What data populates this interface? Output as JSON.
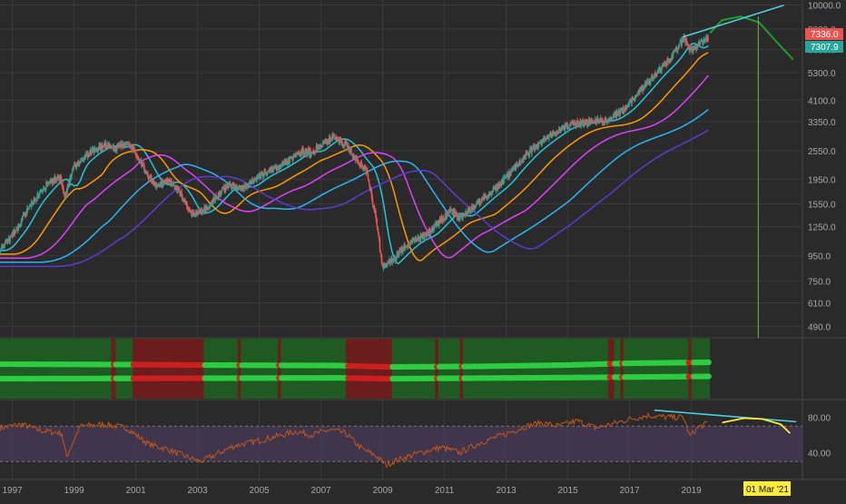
{
  "colors": {
    "background": "#2a2a2a",
    "grid": "#3a3a3a",
    "text": "#a8a8a8",
    "candle_up": "#26a69a",
    "candle_down": "#ef5350",
    "ema_short": "#26c6da",
    "ema_orange": "#ff9800",
    "ema_magenta": "#e040fb",
    "ema_blue": "#29b6f6",
    "ema_purple": "#5c3bd6",
    "projection": "#1f9e2b",
    "trendline": "#4dd0e1",
    "vertical_marker": "#7cb342",
    "rsi_line": "#c2571a",
    "rsi_band": "#4a3a5c",
    "rsi_arc": "#ffeb3b",
    "ribbon_green": "#1e5a22",
    "ribbon_red": "#6b1c1c",
    "ribbon_dot_green": "#2ecc40",
    "ribbon_dot_red": "#cc1f1f",
    "price_tag_red": "#ef5350",
    "price_tag_green": "#26a69a",
    "date_tag": "#ffeb3b"
  },
  "price_labels": {
    "current_red": "7336.0",
    "current_green": "7307.9"
  },
  "date_marker": "01 Mar '21",
  "chart_data": [
    {
      "type": "candlestick",
      "panel": "price",
      "scale": "log",
      "ylim": [
        440,
        10500
      ],
      "y_ticks": [
        "10000.0",
        "8000.0",
        "6600.0",
        "5300.0",
        "4100.0",
        "3350.0",
        "2550.0",
        "1950.0",
        "1550.0",
        "1250.0",
        "950.0",
        "750.0",
        "610.0",
        "490.0"
      ],
      "x_ticks": [
        "1997",
        "1999",
        "2001",
        "2003",
        "2005",
        "2007",
        "2009",
        "2011",
        "2013",
        "2015",
        "2017",
        "2019"
      ],
      "x_range": [
        1996.6,
        2022.6
      ],
      "price_path": [
        [
          1996.6,
          1000
        ],
        [
          1997.2,
          1250
        ],
        [
          1997.6,
          1550
        ],
        [
          1998.2,
          1900
        ],
        [
          1998.55,
          2000
        ],
        [
          1998.7,
          1650
        ],
        [
          1999.0,
          2200
        ],
        [
          1999.5,
          2500
        ],
        [
          2000.0,
          2700
        ],
        [
          2000.3,
          2600
        ],
        [
          2000.7,
          2750
        ],
        [
          2001.0,
          2500
        ],
        [
          2001.4,
          2000
        ],
        [
          2001.7,
          1800
        ],
        [
          2002.0,
          1950
        ],
        [
          2002.4,
          1750
        ],
        [
          2002.8,
          1400
        ],
        [
          2003.2,
          1450
        ],
        [
          2003.6,
          1650
        ],
        [
          2004.0,
          1850
        ],
        [
          2004.5,
          1800
        ],
        [
          2005.0,
          2000
        ],
        [
          2005.5,
          2150
        ],
        [
          2006.0,
          2350
        ],
        [
          2006.4,
          2550
        ],
        [
          2006.7,
          2500
        ],
        [
          2007.0,
          2700
        ],
        [
          2007.4,
          2900
        ],
        [
          2007.8,
          2700
        ],
        [
          2008.2,
          2300
        ],
        [
          2008.5,
          2100
        ],
        [
          2008.8,
          1300
        ],
        [
          2009.0,
          850
        ],
        [
          2009.25,
          900
        ],
        [
          2009.6,
          1000
        ],
        [
          2010.0,
          1100
        ],
        [
          2010.4,
          1150
        ],
        [
          2010.8,
          1300
        ],
        [
          2011.2,
          1450
        ],
        [
          2011.5,
          1350
        ],
        [
          2011.8,
          1450
        ],
        [
          2012.3,
          1650
        ],
        [
          2012.8,
          1850
        ],
        [
          2013.3,
          2200
        ],
        [
          2013.8,
          2550
        ],
        [
          2014.3,
          2850
        ],
        [
          2014.8,
          3150
        ],
        [
          2015.3,
          3300
        ],
        [
          2015.8,
          3350
        ],
        [
          2016.3,
          3400
        ],
        [
          2016.8,
          3750
        ],
        [
          2017.3,
          4400
        ],
        [
          2017.8,
          5200
        ],
        [
          2018.3,
          6000
        ],
        [
          2018.75,
          7300
        ],
        [
          2019.0,
          6500
        ],
        [
          2019.3,
          7000
        ],
        [
          2019.55,
          7300
        ]
      ],
      "down_periods": [
        [
          2001.0,
          2003.2
        ],
        [
          2007.8,
          2009.3
        ],
        [
          2018.75,
          2019.05
        ],
        [
          2011.4,
          2011.9
        ]
      ],
      "ema_lags": [
        0.35,
        0.9,
        1.6,
        2.6,
        3.6
      ],
      "series": [
        {
          "role": "ema_short",
          "lag": 0.35
        },
        {
          "role": "ema_orange",
          "lag": 0.9
        },
        {
          "role": "ema_magenta",
          "lag": 1.6
        },
        {
          "role": "ema_blue",
          "lag": 2.6
        },
        {
          "role": "ema_purple",
          "lag": 3.6
        }
      ],
      "projection": [
        [
          2019.6,
          7700
        ],
        [
          2020.0,
          8700
        ],
        [
          2020.6,
          9000
        ],
        [
          2021.2,
          8500
        ],
        [
          2021.8,
          7000
        ],
        [
          2022.3,
          6000
        ]
      ],
      "trendline": [
        [
          2018.7,
          7400
        ],
        [
          2022.0,
          10000
        ]
      ],
      "vertical_marker_x": 2021.17
    },
    {
      "type": "ribbon",
      "panel": "trend_ribbon",
      "x_range": [
        1996.6,
        2019.6
      ],
      "red_spans": [
        [
          2000.2,
          2000.35
        ],
        [
          2000.9,
          2003.2
        ],
        [
          2004.3,
          2004.4
        ],
        [
          2005.6,
          2005.7
        ],
        [
          2007.8,
          2009.3
        ],
        [
          2010.7,
          2010.8
        ],
        [
          2011.5,
          2011.6
        ],
        [
          2016.3,
          2016.5
        ],
        [
          2016.7,
          2016.8
        ],
        [
          2018.9,
          2019.0
        ]
      ],
      "upper_line": [
        [
          1996.6,
          2.0
        ],
        [
          2001.0,
          2.5
        ],
        [
          2003.0,
          3.0
        ],
        [
          2007.5,
          3.5
        ],
        [
          2009.2,
          5.0
        ],
        [
          2012.0,
          4.5
        ],
        [
          2015.0,
          3.0
        ],
        [
          2017.0,
          1.0
        ],
        [
          2019.5,
          0.0
        ]
      ],
      "lower_line": [
        [
          1996.6,
          8.0
        ],
        [
          2002.0,
          7.6
        ],
        [
          2007.5,
          7.1
        ],
        [
          2009.2,
          8.0
        ],
        [
          2012.0,
          7.4
        ],
        [
          2015.0,
          6.8
        ],
        [
          2019.5,
          5.5
        ]
      ]
    },
    {
      "type": "line",
      "panel": "rsi",
      "ylim": [
        20,
        100
      ],
      "y_ticks": [
        "80.00",
        "40.00"
      ],
      "upper_band": 70,
      "lower_band": 30,
      "rsi": [
        [
          1996.6,
          68
        ],
        [
          1997.3,
          72
        ],
        [
          1997.9,
          65
        ],
        [
          1998.6,
          62
        ],
        [
          1998.75,
          35
        ],
        [
          1999.2,
          70
        ],
        [
          2000.0,
          72
        ],
        [
          2000.7,
          68
        ],
        [
          2001.4,
          50
        ],
        [
          2002.0,
          44
        ],
        [
          2002.6,
          36
        ],
        [
          2003.1,
          30
        ],
        [
          2003.6,
          38
        ],
        [
          2004.2,
          48
        ],
        [
          2004.8,
          52
        ],
        [
          2005.5,
          58
        ],
        [
          2006.2,
          64
        ],
        [
          2006.7,
          60
        ],
        [
          2007.3,
          66
        ],
        [
          2007.8,
          62
        ],
        [
          2008.3,
          45
        ],
        [
          2008.8,
          36
        ],
        [
          2009.1,
          26
        ],
        [
          2009.5,
          32
        ],
        [
          2010.2,
          40
        ],
        [
          2010.9,
          46
        ],
        [
          2011.5,
          40
        ],
        [
          2012.2,
          52
        ],
        [
          2012.9,
          60
        ],
        [
          2013.5,
          68
        ],
        [
          2014.1,
          74
        ],
        [
          2014.7,
          70
        ],
        [
          2015.3,
          76
        ],
        [
          2015.9,
          68
        ],
        [
          2016.4,
          72
        ],
        [
          2017.0,
          78
        ],
        [
          2017.6,
          82
        ],
        [
          2018.2,
          80
        ],
        [
          2018.75,
          80
        ],
        [
          2018.95,
          58
        ],
        [
          2019.2,
          68
        ],
        [
          2019.55,
          74
        ]
      ],
      "trendline": [
        [
          2017.8,
          88
        ],
        [
          2022.4,
          75
        ]
      ],
      "arc": [
        [
          2020.0,
          74
        ],
        [
          2020.7,
          79
        ],
        [
          2021.3,
          78
        ],
        [
          2021.9,
          72
        ],
        [
          2022.2,
          62
        ]
      ]
    }
  ]
}
